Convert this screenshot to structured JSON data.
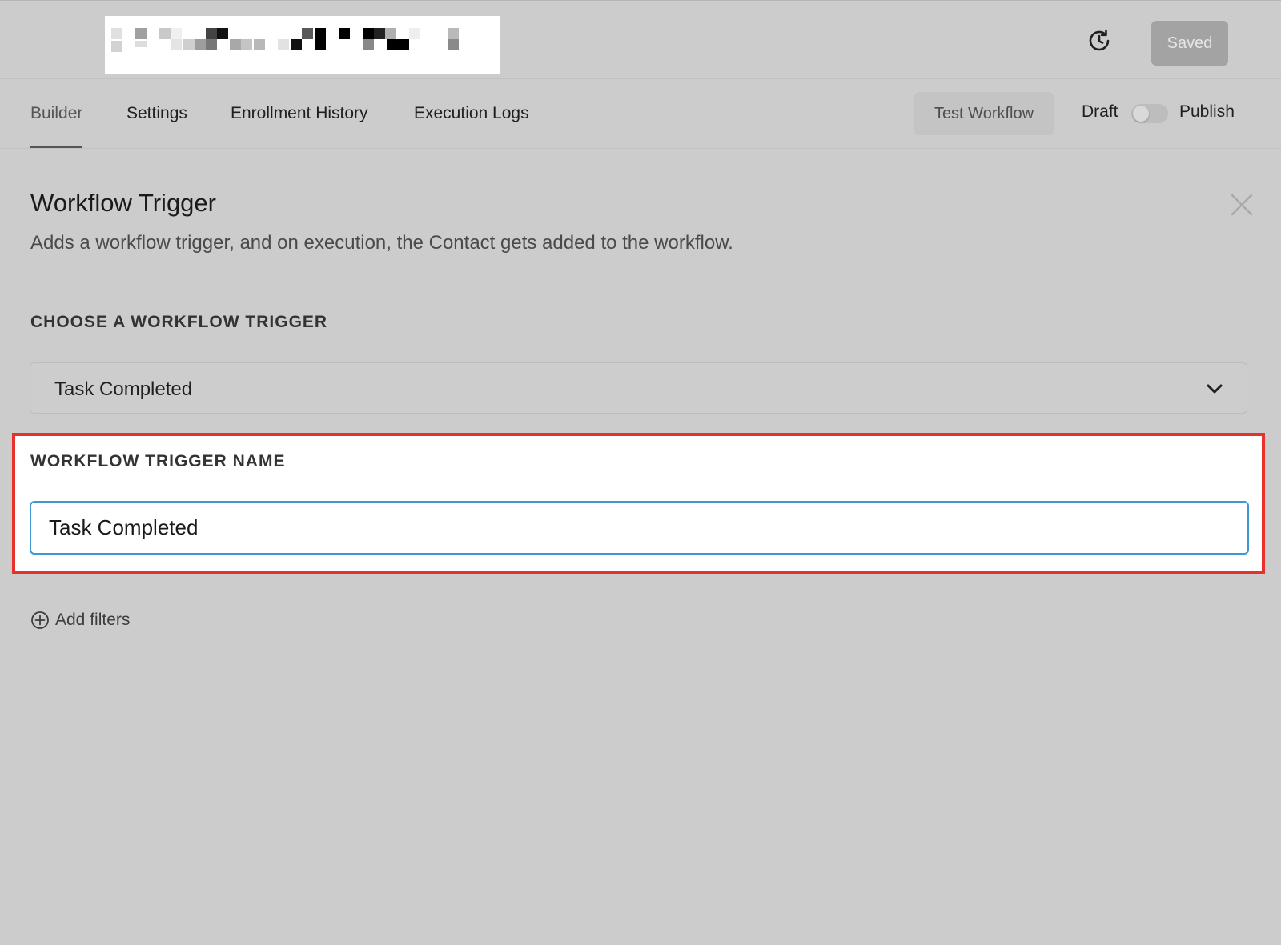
{
  "header": {
    "workflow_name_redacted": true,
    "history_icon": "history-clock-icon",
    "saved_label": "Saved"
  },
  "tabs": [
    {
      "label": "Builder",
      "active": true
    },
    {
      "label": "Settings",
      "active": false
    },
    {
      "label": "Enrollment History",
      "active": false
    },
    {
      "label": "Execution Logs",
      "active": false
    }
  ],
  "actions": {
    "test_workflow_label": "Test Workflow",
    "draft_label": "Draft",
    "publish_label": "Publish",
    "published": false
  },
  "panel": {
    "title": "Workflow Trigger",
    "description": "Adds a workflow trigger, and on execution, the Contact gets added to the workflow.",
    "close_icon": "close-icon",
    "choose_trigger_label": "CHOOSE A WORKFLOW TRIGGER",
    "selected_trigger": "Task Completed",
    "trigger_name_label": "WORKFLOW TRIGGER NAME",
    "trigger_name_value": "Task Completed",
    "add_filters_label": "Add filters",
    "add_filters_icon": "plus-circle-icon"
  },
  "colors": {
    "background": "#cccccc",
    "highlight_border": "#e8312a",
    "input_focus_border": "#3e96d3",
    "saved_button_bg": "#a3a3a3"
  }
}
